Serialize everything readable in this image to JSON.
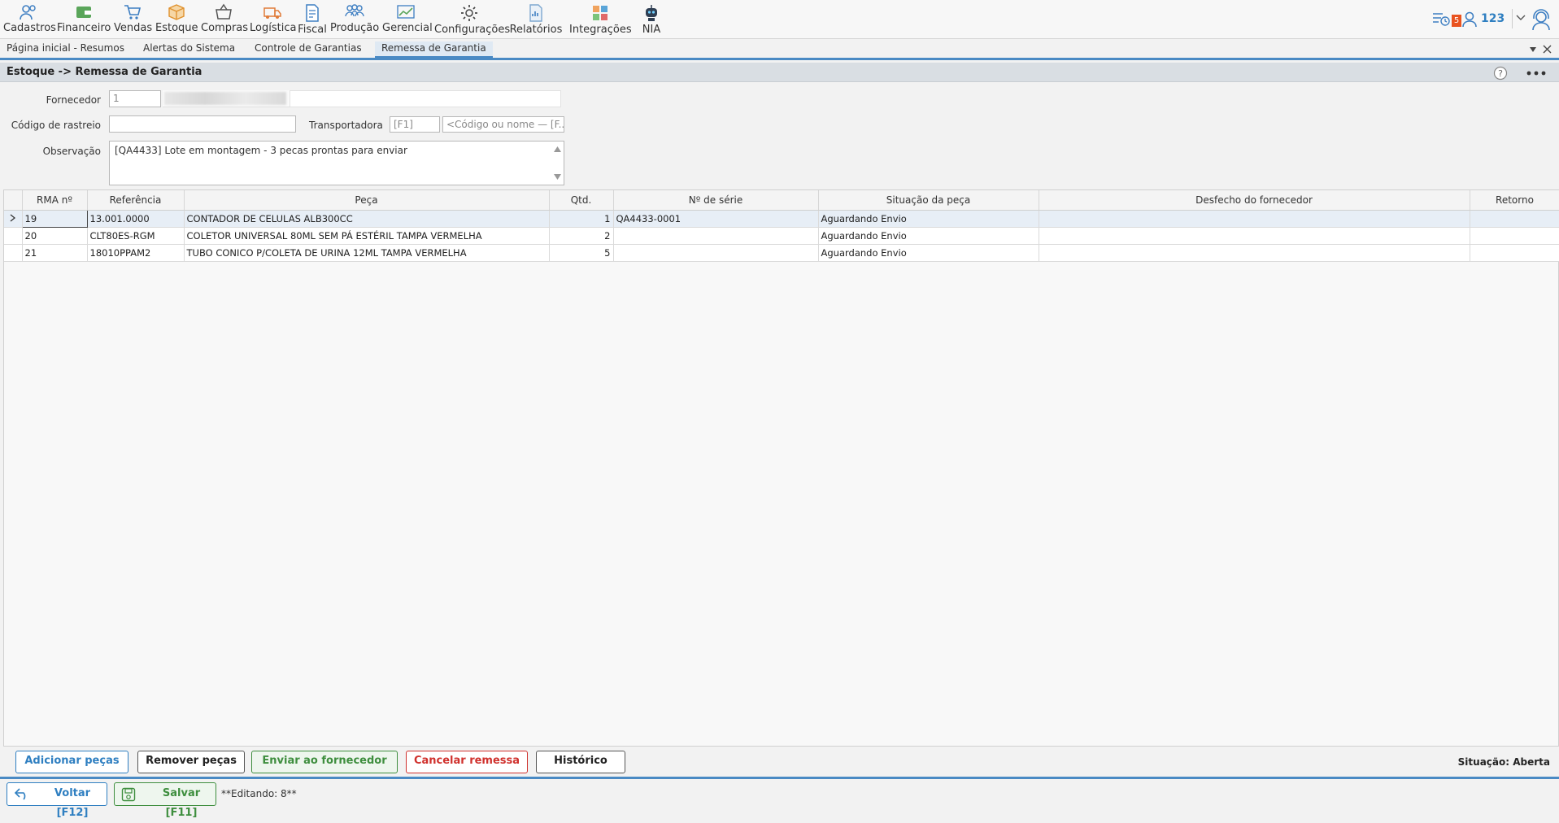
{
  "menu": {
    "items": [
      {
        "label": "Cadastros",
        "icon": "people-icon"
      },
      {
        "label": "Financeiro",
        "icon": "wallet-icon"
      },
      {
        "label": "Vendas",
        "icon": "cart-icon"
      },
      {
        "label": "Estoque",
        "icon": "box-icon"
      },
      {
        "label": "Compras",
        "icon": "basket-icon"
      },
      {
        "label": "Logística",
        "icon": "truck-icon"
      },
      {
        "label": "Fiscal",
        "icon": "document-icon"
      },
      {
        "label": "Produção",
        "icon": "team-icon"
      },
      {
        "label": "Gerencial",
        "icon": "chart-icon"
      },
      {
        "label": "Configurações",
        "icon": "gear-icon"
      },
      {
        "label": "Relatórios",
        "icon": "report-icon"
      },
      {
        "label": "Integrações",
        "icon": "puzzle-icon"
      },
      {
        "label": "NIA",
        "icon": "robot-icon"
      }
    ],
    "notification_count": "5",
    "user": "123"
  },
  "tabs": [
    {
      "label": "Página inicial - Resumos"
    },
    {
      "label": "Alertas do Sistema"
    },
    {
      "label": "Controle de Garantias"
    },
    {
      "label": "Remessa de Garantia"
    }
  ],
  "page": {
    "title": "Estoque -> Remessa de Garantia"
  },
  "form": {
    "fornecedor_label": "Fornecedor",
    "fornecedor_code": "1",
    "rastreio_label": "Código de rastreio",
    "rastreio_value": "",
    "transportadora_label": "Transportadora",
    "transportadora_code_placeholder": "[F1]",
    "transportadora_name_placeholder": "<Código ou nome — [F...",
    "observacao_label": "Observação",
    "observacao_value": "[QA4433] Lote em montagem - 3 pecas prontas para enviar"
  },
  "grid": {
    "columns": [
      "RMA nº",
      "Referência",
      "Peça",
      "Qtd.",
      "Nº de série",
      "Situação da peça",
      "Desfecho do fornecedor",
      "Retorno"
    ],
    "rows": [
      [
        "19",
        "13.001.0000",
        "CONTADOR DE CELULAS ALB300CC",
        "1",
        "QA4433-0001",
        "Aguardando Envio",
        "",
        ""
      ],
      [
        "20",
        "CLT80ES-RGM",
        "COLETOR UNIVERSAL 80ML SEM PÁ ESTÉRIL TAMPA VERMELHA",
        "2",
        "",
        "Aguardando Envio",
        "",
        ""
      ],
      [
        "21",
        "18010PPAM2",
        "TUBO CONICO P/COLETA DE URINA 12ML TAMPA VERMELHA",
        "5",
        "",
        "Aguardando Envio",
        "",
        ""
      ]
    ]
  },
  "actions": {
    "add": "Adicionar peças",
    "remove": "Remover peças",
    "send": "Enviar ao fornecedor",
    "cancel": "Cancelar remessa",
    "history": "Histórico",
    "status": "Situação: Aberta"
  },
  "footer": {
    "back": "Voltar [F12]",
    "save": "Salvar [F11]",
    "editing": "**Editando: 8**"
  },
  "colors": {
    "accent": "#4a8ac4",
    "primary_btn": "#2f7fc1",
    "success_btn": "#3e8e3e",
    "danger_btn": "#d0312d"
  }
}
